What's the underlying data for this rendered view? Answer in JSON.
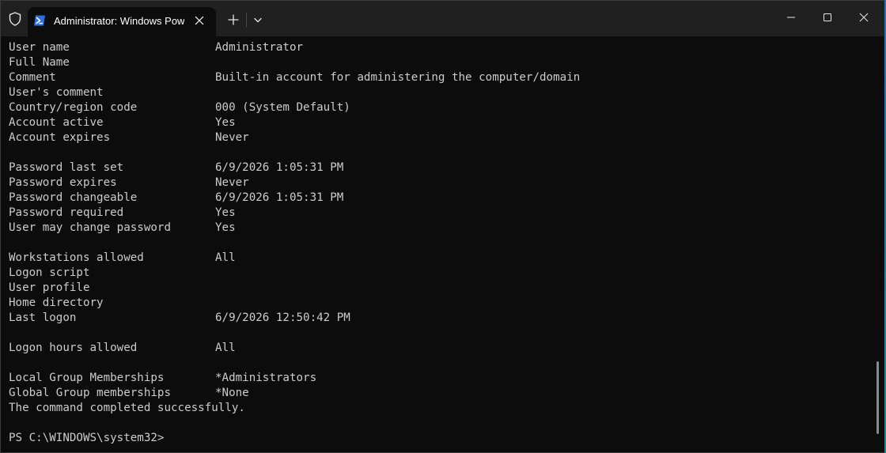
{
  "window": {
    "tab_title": "Administrator: Windows PowerShell",
    "icons": {
      "shield": "shield-icon",
      "powershell": "powershell-icon",
      "close_tab": "close-icon",
      "new_tab": "plus-icon",
      "dropdown": "chevron-down-icon",
      "minimize": "minimize-icon",
      "maximize": "maximize-icon",
      "close": "close-icon"
    },
    "colors": {
      "titlebar": "#202020",
      "terminal_bg": "#0c0c0c",
      "text": "#cccccc",
      "powershell_blue": "#2a6fdb"
    }
  },
  "terminal": {
    "lines": [
      {
        "key": "User name",
        "value": "Administrator"
      },
      {
        "key": "Full Name",
        "value": ""
      },
      {
        "key": "Comment",
        "value": "Built-in account for administering the computer/domain"
      },
      {
        "key": "User's comment",
        "value": ""
      },
      {
        "key": "Country/region code",
        "value": "000 (System Default)"
      },
      {
        "key": "Account active",
        "value": "Yes"
      },
      {
        "key": "Account expires",
        "value": "Never"
      },
      {
        "key": "",
        "value": ""
      },
      {
        "key": "Password last set",
        "value": "6/9/2026 1:05:31 PM"
      },
      {
        "key": "Password expires",
        "value": "Never"
      },
      {
        "key": "Password changeable",
        "value": "6/9/2026 1:05:31 PM"
      },
      {
        "key": "Password required",
        "value": "Yes"
      },
      {
        "key": "User may change password",
        "value": "Yes"
      },
      {
        "key": "",
        "value": ""
      },
      {
        "key": "Workstations allowed",
        "value": "All"
      },
      {
        "key": "Logon script",
        "value": ""
      },
      {
        "key": "User profile",
        "value": ""
      },
      {
        "key": "Home directory",
        "value": ""
      },
      {
        "key": "Last logon",
        "value": "6/9/2026 12:50:42 PM"
      },
      {
        "key": "",
        "value": ""
      },
      {
        "key": "Logon hours allowed",
        "value": "All"
      },
      {
        "key": "",
        "value": ""
      },
      {
        "key": "Local Group Memberships",
        "value": "*Administrators"
      },
      {
        "key": "Global Group memberships",
        "value": "*None"
      },
      {
        "key": "The command completed successfully.",
        "value": ""
      },
      {
        "key": "",
        "value": ""
      },
      {
        "key": "PS C:\\WINDOWS\\system32>",
        "value": ""
      }
    ]
  }
}
